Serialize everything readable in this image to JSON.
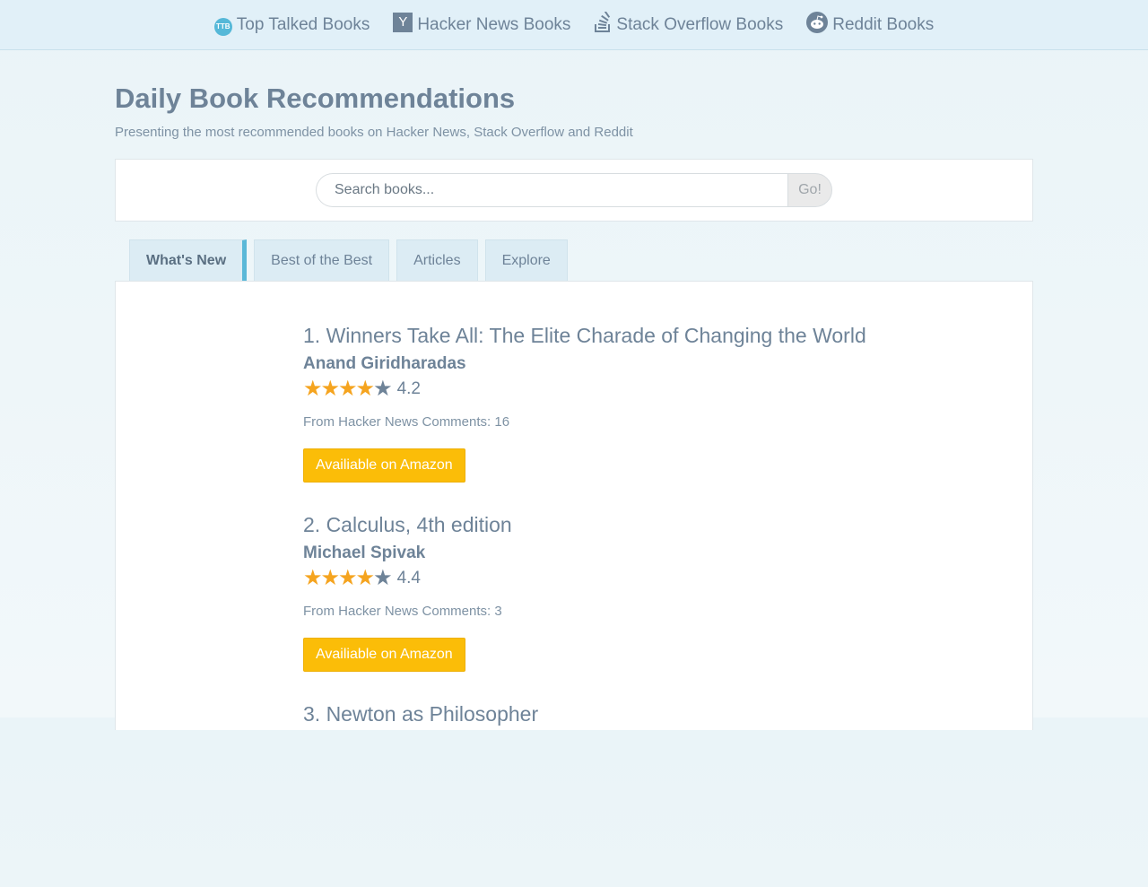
{
  "nav": {
    "items": [
      {
        "label": "Top Talked Books",
        "icon": "ttb-logo-icon",
        "icon_text": "TTB"
      },
      {
        "label": "Hacker News Books",
        "icon": "hacker-news-icon",
        "icon_text": "Y"
      },
      {
        "label": "Stack Overflow Books",
        "icon": "stack-overflow-icon"
      },
      {
        "label": "Reddit Books",
        "icon": "reddit-icon"
      }
    ]
  },
  "header": {
    "title": "Daily Book Recommendations",
    "subtitle": "Presenting the most recommended books on Hacker News, Stack Overflow and Reddit"
  },
  "search": {
    "placeholder": "Search books...",
    "button_label": "Go!"
  },
  "tabs": [
    {
      "label": "What's New",
      "active": true
    },
    {
      "label": "Best of the Best",
      "active": false
    },
    {
      "label": "Articles",
      "active": false
    },
    {
      "label": "Explore",
      "active": false
    }
  ],
  "books": [
    {
      "title": "1. Winners Take All: The Elite Charade of Changing the World",
      "author": "Anand Giridharadas",
      "rating": "4.2",
      "stars_filled": 4,
      "comments": "From Hacker News Comments: 16",
      "button_label": "Availiable on Amazon"
    },
    {
      "title": "2. Calculus, 4th edition",
      "author": "Michael Spivak",
      "rating": "4.4",
      "stars_filled": 4,
      "comments": "From Hacker News Comments: 3",
      "button_label": "Availiable on Amazon"
    },
    {
      "title": "3. Newton as Philosopher"
    }
  ],
  "colors": {
    "accent": "#5ab8d8",
    "star": "#f5a41f",
    "amazon_button": "#fbbd08",
    "text": "#6e8398"
  }
}
